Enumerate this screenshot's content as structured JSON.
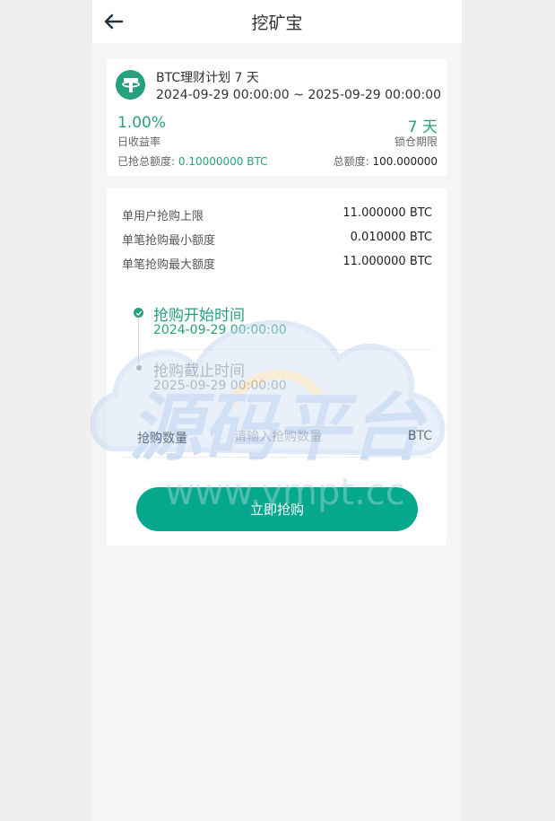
{
  "header": {
    "title": "挖矿宝"
  },
  "plan": {
    "name": "BTC理财计划 7 天",
    "range": "2024-09-29 00:00:00 ~ 2025-09-29 00:00:00",
    "daily_rate": "1.00%",
    "daily_rate_label": "日收益率",
    "lock_days": "7 天",
    "lock_label": "锁仓期限",
    "sold_label": "已抢总额度:",
    "sold_value": "0.10000000 BTC",
    "total_label": "总额度:",
    "total_value": "100.000000"
  },
  "limits": [
    {
      "label": "单用户抢购上限",
      "value": "11.000000 BTC"
    },
    {
      "label": "单笔抢购最小额度",
      "value": "0.010000 BTC"
    },
    {
      "label": "单笔抢购最大额度",
      "value": "11.000000 BTC"
    }
  ],
  "timeline": {
    "start_title": "抢购开始时间",
    "start_time": "2024-09-29 00:00:00",
    "end_title": "抢购截止时间",
    "end_time": "2025-09-29 00:00:00"
  },
  "form": {
    "qty_label": "抢购数量",
    "qty_placeholder": "请输入抢购数量",
    "qty_value": "",
    "unit": "BTC",
    "submit_label": "立即抢购"
  },
  "watermark": {
    "text": "源码平台",
    "url": "www.ympt.cc"
  },
  "colors": {
    "accent": "#26a17b",
    "button": "#05a88d"
  }
}
